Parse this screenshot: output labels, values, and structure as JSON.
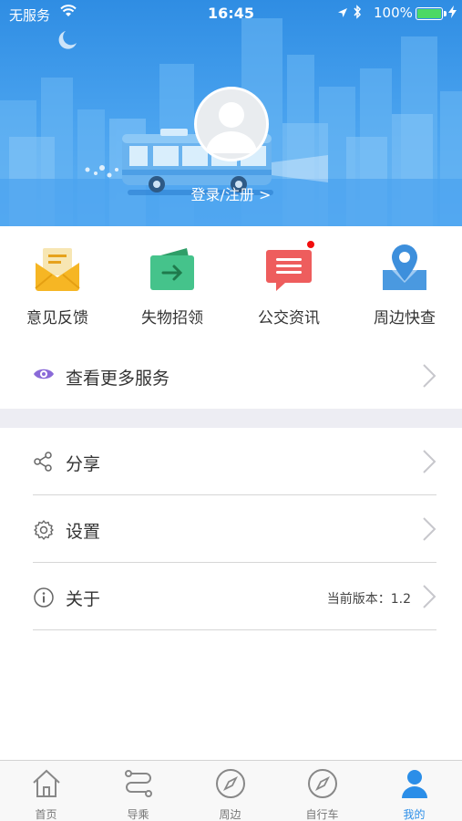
{
  "status_bar": {
    "carrier": "无服务",
    "time": "16:45",
    "battery": "100%",
    "battery_level": 1.0
  },
  "header": {
    "login_label": "登录/注册 >"
  },
  "quick_actions": [
    {
      "label": "意见反馈",
      "icon": "envelope-icon",
      "color": "#f5b324"
    },
    {
      "label": "失物招领",
      "icon": "wallet-arrow-icon",
      "color": "#3fbf84"
    },
    {
      "label": "公交资讯",
      "icon": "message-icon",
      "color": "#ef5b5b"
    },
    {
      "label": "周边快查",
      "icon": "map-pin-icon",
      "color": "#3d8fdc"
    }
  ],
  "more_services": {
    "label": "查看更多服务",
    "icon": "eye-icon"
  },
  "menu": [
    {
      "label": "分享",
      "icon": "share-icon"
    },
    {
      "label": "设置",
      "icon": "gear-icon"
    },
    {
      "label": "关于",
      "icon": "info-icon",
      "version_label": "当前版本：1.2"
    }
  ],
  "tabbar": [
    {
      "label": "首页",
      "icon": "home-icon"
    },
    {
      "label": "导乘",
      "icon": "route-icon"
    },
    {
      "label": "周边",
      "icon": "compass-icon"
    },
    {
      "label": "自行车",
      "icon": "compass-icon"
    },
    {
      "label": "我的",
      "icon": "user-icon",
      "active": true
    }
  ],
  "colors": {
    "header": "#3d9be9",
    "accent": "#2b8ee8",
    "badge": "#f20d0d"
  }
}
